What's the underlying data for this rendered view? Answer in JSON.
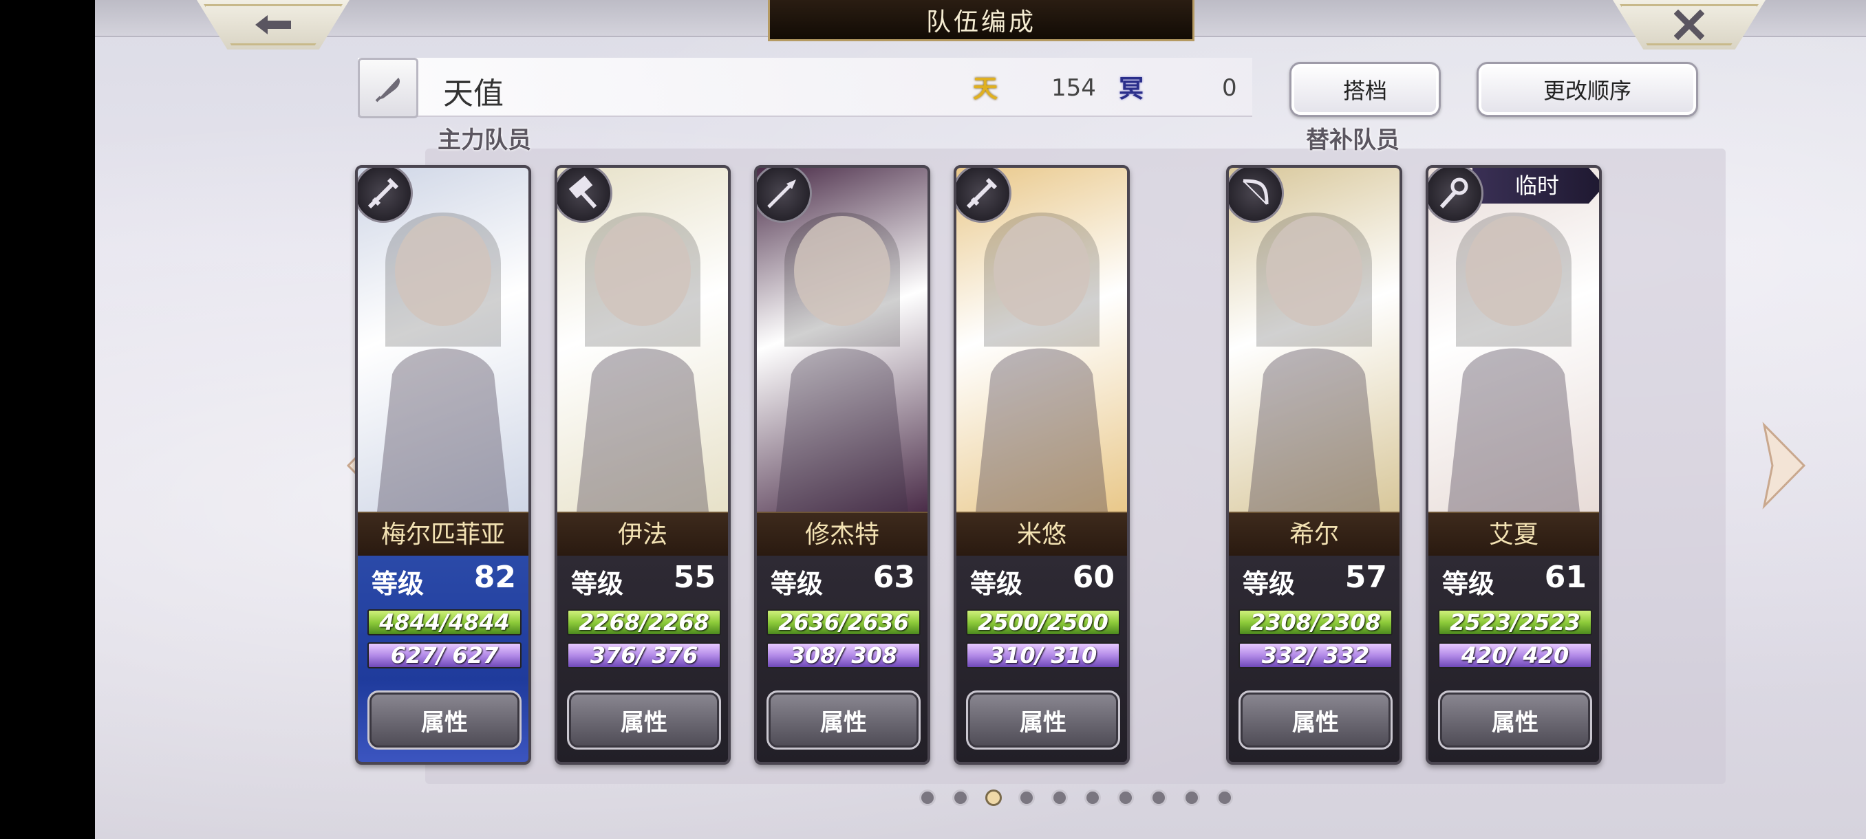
{
  "header": {
    "title": "队伍编成"
  },
  "team": {
    "name": "天值",
    "heaven_symbol": "天",
    "heaven_value": "154",
    "hell_symbol": "冥",
    "hell_value": "0"
  },
  "buttons": {
    "partner": "搭档",
    "change_order": "更改顺序"
  },
  "sections": {
    "main": "主力队员",
    "substitute": "替补队员"
  },
  "cards": [
    {
      "name": "梅尔匹菲亚",
      "level_label": "等级",
      "level": "82",
      "hp": "4844/4844",
      "mp": "627/ 627",
      "attr": "属性",
      "role_icon": "sword-icon",
      "bg": "#cfd6e6"
    },
    {
      "name": "伊法",
      "level_label": "等级",
      "level": "55",
      "hp": "2268/2268",
      "mp": "376/ 376",
      "attr": "属性",
      "role_icon": "hammer-icon",
      "bg": "#e7e1c8"
    },
    {
      "name": "修杰特",
      "level_label": "等级",
      "level": "63",
      "hp": "2636/2636",
      "mp": "308/ 308",
      "attr": "属性",
      "role_icon": "spear-icon",
      "bg": "#4a2c48"
    },
    {
      "name": "米悠",
      "level_label": "等级",
      "level": "60",
      "hp": "2500/2500",
      "mp": "310/ 310",
      "attr": "属性",
      "role_icon": "sword-icon",
      "bg": "#e9c88a"
    },
    {
      "name": "希尔",
      "level_label": "等级",
      "level": "57",
      "hp": "2308/2308",
      "mp": "332/ 332",
      "attr": "属性",
      "role_icon": "bow-icon",
      "bg": "#d8c79a"
    },
    {
      "name": "艾夏",
      "level_label": "等级",
      "level": "61",
      "hp": "2523/2523",
      "mp": "420/ 420",
      "attr": "属性",
      "role_icon": "staff-icon",
      "bg": "#e8dcd8",
      "badge": "临时"
    }
  ],
  "pagination": {
    "total": 10,
    "active_index": 2
  }
}
